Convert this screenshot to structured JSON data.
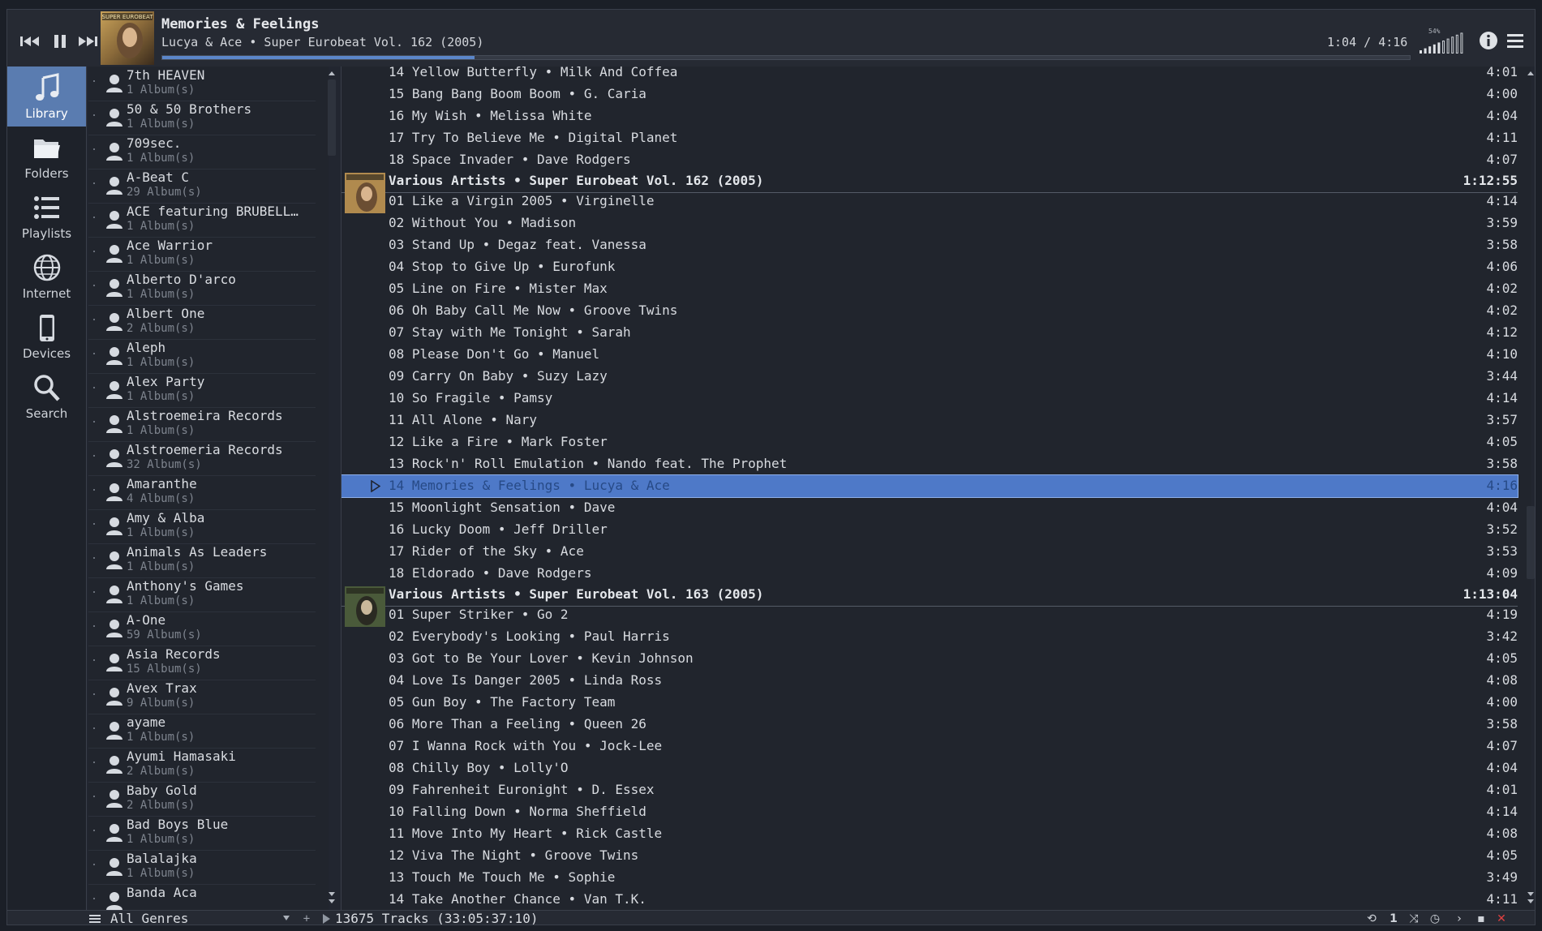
{
  "player": {
    "title": "Memories & Feelings",
    "subtitle": "Lucya & Ace • Super Eurobeat Vol. 162 (2005)",
    "time": "1:04 / 4:16",
    "progress": 0.25,
    "volume_label": "54%",
    "volume": 0.54
  },
  "sidebar": {
    "items": [
      {
        "label": "Library",
        "icon": "music-note-icon"
      },
      {
        "label": "Folders",
        "icon": "folder-icon"
      },
      {
        "label": "Playlists",
        "icon": "playlist-icon"
      },
      {
        "label": "Internet",
        "icon": "globe-icon"
      },
      {
        "label": "Devices",
        "icon": "phone-icon"
      },
      {
        "label": "Search",
        "icon": "search-icon"
      }
    ]
  },
  "artists": [
    {
      "name": "7th HEAVEN",
      "count": "1 Album(s)"
    },
    {
      "name": "50 & 50 Brothers",
      "count": "1 Album(s)"
    },
    {
      "name": "709sec.",
      "count": "1 Album(s)"
    },
    {
      "name": "A-Beat C",
      "count": "29 Album(s)"
    },
    {
      "name": "ACE featuring BRUBELL…",
      "count": "1 Album(s)"
    },
    {
      "name": "Ace Warrior",
      "count": "1 Album(s)"
    },
    {
      "name": "Alberto D'arco",
      "count": "1 Album(s)"
    },
    {
      "name": "Albert One",
      "count": "2 Album(s)"
    },
    {
      "name": "Aleph",
      "count": "1 Album(s)"
    },
    {
      "name": "Alex Party",
      "count": "1 Album(s)"
    },
    {
      "name": "Alstroemeira Records",
      "count": "1 Album(s)"
    },
    {
      "name": "Alstroemeria Records",
      "count": "32 Album(s)"
    },
    {
      "name": "Amaranthe",
      "count": "4 Album(s)"
    },
    {
      "name": "Amy & Alba",
      "count": "1 Album(s)"
    },
    {
      "name": "Animals As Leaders",
      "count": "1 Album(s)"
    },
    {
      "name": "Anthony's Games",
      "count": "1 Album(s)"
    },
    {
      "name": "A-One",
      "count": "59 Album(s)"
    },
    {
      "name": "Asia Records",
      "count": "15 Album(s)"
    },
    {
      "name": "Avex Trax",
      "count": "9 Album(s)"
    },
    {
      "name": "ayame",
      "count": "1 Album(s)"
    },
    {
      "name": "Ayumi Hamasaki",
      "count": "2 Album(s)"
    },
    {
      "name": "Baby Gold",
      "count": "2 Album(s)"
    },
    {
      "name": "Bad Boys Blue",
      "count": "1 Album(s)"
    },
    {
      "name": "Balalajka",
      "count": "1 Album(s)"
    },
    {
      "name": "Banda Aca",
      "count": ""
    }
  ],
  "tracks": {
    "pre": [
      {
        "t": "14 Yellow Butterfly • Milk And Coffea",
        "d": "4:01"
      },
      {
        "t": "15 Bang Bang Boom Boom • G. Caria",
        "d": "4:00"
      },
      {
        "t": "16 My Wish • Melissa White",
        "d": "4:04"
      },
      {
        "t": "17 Try To Believe Me • Digital Planet",
        "d": "4:11"
      },
      {
        "t": "18 Space Invader • Dave Rodgers",
        "d": "4:07"
      }
    ],
    "album162": {
      "header": "Various Artists • Super Eurobeat Vol. 162 (2005)",
      "duration": "1:12:55",
      "items": [
        {
          "t": "01 Like a Virgin 2005 • Virginelle",
          "d": "4:14"
        },
        {
          "t": "02 Without You • Madison",
          "d": "3:59"
        },
        {
          "t": "03 Stand Up • Degaz feat. Vanessa",
          "d": "3:58"
        },
        {
          "t": "04 Stop to Give Up • Eurofunk",
          "d": "4:06"
        },
        {
          "t": "05 Line on Fire • Mister Max",
          "d": "4:02"
        },
        {
          "t": "06 Oh Baby Call Me Now • Groove Twins",
          "d": "4:02"
        },
        {
          "t": "07 Stay with Me Tonight • Sarah",
          "d": "4:12"
        },
        {
          "t": "08 Please Don't Go • Manuel",
          "d": "4:10"
        },
        {
          "t": "09 Carry On Baby • Suzy Lazy",
          "d": "3:44"
        },
        {
          "t": "10 So Fragile • Pamsy",
          "d": "4:14"
        },
        {
          "t": "11 All Alone • Nary",
          "d": "3:57"
        },
        {
          "t": "12 Like a Fire • Mark Foster",
          "d": "4:05"
        },
        {
          "t": "13 Rock'n' Roll Emulation • Nando feat. The Prophet",
          "d": "3:58"
        },
        {
          "t": "14 Memories & Feelings • Lucya & Ace",
          "d": "4:16"
        },
        {
          "t": "15 Moonlight Sensation • Dave",
          "d": "4:04"
        },
        {
          "t": "16 Lucky Doom • Jeff Driller",
          "d": "3:52"
        },
        {
          "t": "17 Rider of the Sky • Ace",
          "d": "3:53"
        },
        {
          "t": "18 Eldorado • Dave Rodgers",
          "d": "4:09"
        }
      ]
    },
    "album163": {
      "header": "Various Artists • Super Eurobeat Vol. 163 (2005)",
      "duration": "1:13:04",
      "items": [
        {
          "t": "01 Super Striker • Go 2",
          "d": "4:19"
        },
        {
          "t": "02 Everybody's Looking • Paul Harris",
          "d": "3:42"
        },
        {
          "t": "03 Got to Be Your Lover • Kevin Johnson",
          "d": "4:05"
        },
        {
          "t": "04 Love Is Danger 2005 • Linda Ross",
          "d": "4:08"
        },
        {
          "t": "05 Gun Boy • The Factory Team",
          "d": "4:00"
        },
        {
          "t": "06 More Than a Feeling • Queen 26",
          "d": "3:58"
        },
        {
          "t": "07 I Wanna Rock with You • Jock-Lee",
          "d": "4:07"
        },
        {
          "t": "08 Chilly Boy • Lolly'O",
          "d": "4:04"
        },
        {
          "t": "09 Fahrenheit Euronight • D. Essex",
          "d": "4:01"
        },
        {
          "t": "10 Falling Down • Norma Sheffield",
          "d": "4:14"
        },
        {
          "t": "11 Move Into My Heart • Rick Castle",
          "d": "4:08"
        },
        {
          "t": "12 Viva The Night • Groove Twins",
          "d": "4:05"
        },
        {
          "t": "13 Touch Me Touch Me • Sophie",
          "d": "3:49"
        },
        {
          "t": "14 Take Another Chance • Van T.K.",
          "d": "4:11"
        }
      ]
    }
  },
  "status": {
    "genre": "All Genres",
    "track_count": "13675 Tracks (33:05:37:10)",
    "queue_count": "1"
  },
  "colors": {
    "accent": "#5a7cb0",
    "selection": "#4e79c8",
    "background": "#222630"
  }
}
